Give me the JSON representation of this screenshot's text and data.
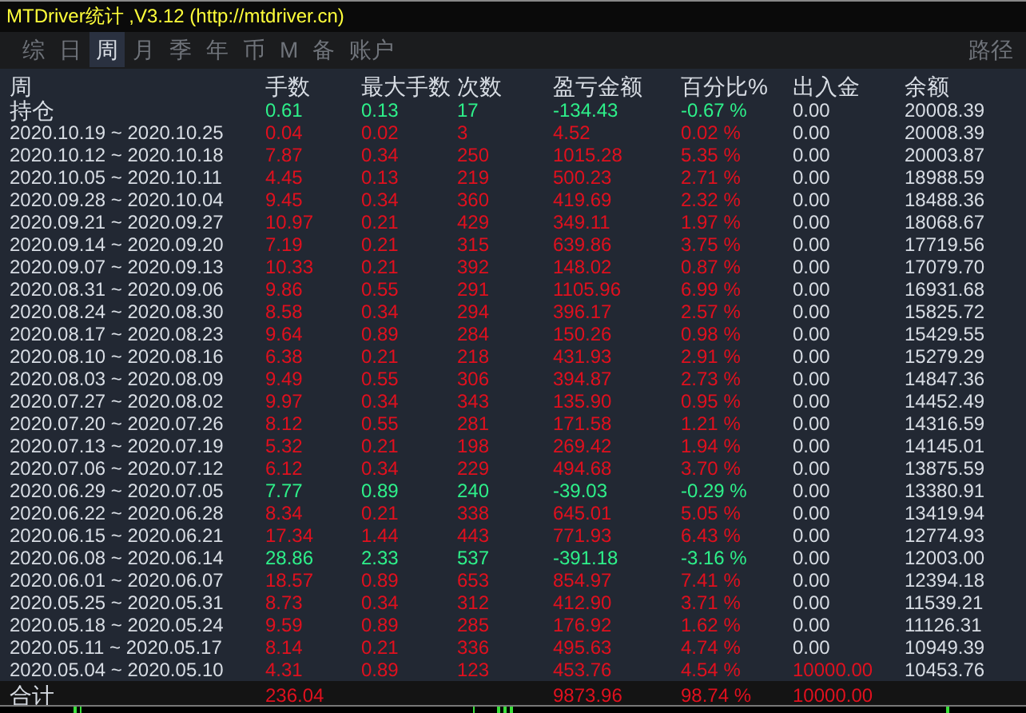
{
  "window": {
    "title": "MTDriver统计 ,V3.12 (http://mtdriver.cn)"
  },
  "tabs": [
    {
      "label": "综",
      "selected": false
    },
    {
      "label": "日",
      "selected": false
    },
    {
      "label": "周",
      "selected": true
    },
    {
      "label": "月",
      "selected": false
    },
    {
      "label": "季",
      "selected": false
    },
    {
      "label": "年",
      "selected": false
    },
    {
      "label": "币",
      "selected": false
    },
    {
      "label": "M",
      "selected": false
    },
    {
      "label": "备",
      "selected": false
    },
    {
      "label": "账户",
      "selected": false
    },
    {
      "label": "路径",
      "selected": false
    }
  ],
  "table": {
    "columns": [
      "周",
      "手数",
      "最大手数",
      "次数",
      "盈亏金额",
      "百分比%",
      "出入金",
      "余额"
    ],
    "rows": [
      {
        "period": "持仓",
        "lots": "0.61",
        "max_lots": "0.13",
        "count": "17",
        "pl": "-134.43",
        "pct": "-0.67 %",
        "deposit": "0.00",
        "balance": "20008.39",
        "loss": true,
        "deposit_nonzero": false
      },
      {
        "period": "2020.10.19 ~ 2020.10.25",
        "lots": "0.04",
        "max_lots": "0.02",
        "count": "3",
        "pl": "4.52",
        "pct": "0.02 %",
        "deposit": "0.00",
        "balance": "20008.39",
        "loss": false,
        "deposit_nonzero": false
      },
      {
        "period": "2020.10.12 ~ 2020.10.18",
        "lots": "7.87",
        "max_lots": "0.34",
        "count": "250",
        "pl": "1015.28",
        "pct": "5.35 %",
        "deposit": "0.00",
        "balance": "20003.87",
        "loss": false,
        "deposit_nonzero": false
      },
      {
        "period": "2020.10.05 ~ 2020.10.11",
        "lots": "4.45",
        "max_lots": "0.13",
        "count": "219",
        "pl": "500.23",
        "pct": "2.71 %",
        "deposit": "0.00",
        "balance": "18988.59",
        "loss": false,
        "deposit_nonzero": false
      },
      {
        "period": "2020.09.28 ~ 2020.10.04",
        "lots": "9.45",
        "max_lots": "0.34",
        "count": "360",
        "pl": "419.69",
        "pct": "2.32 %",
        "deposit": "0.00",
        "balance": "18488.36",
        "loss": false,
        "deposit_nonzero": false
      },
      {
        "period": "2020.09.21 ~ 2020.09.27",
        "lots": "10.97",
        "max_lots": "0.21",
        "count": "429",
        "pl": "349.11",
        "pct": "1.97 %",
        "deposit": "0.00",
        "balance": "18068.67",
        "loss": false,
        "deposit_nonzero": false
      },
      {
        "period": "2020.09.14 ~ 2020.09.20",
        "lots": "7.19",
        "max_lots": "0.21",
        "count": "315",
        "pl": "639.86",
        "pct": "3.75 %",
        "deposit": "0.00",
        "balance": "17719.56",
        "loss": false,
        "deposit_nonzero": false
      },
      {
        "period": "2020.09.07 ~ 2020.09.13",
        "lots": "10.33",
        "max_lots": "0.21",
        "count": "392",
        "pl": "148.02",
        "pct": "0.87 %",
        "deposit": "0.00",
        "balance": "17079.70",
        "loss": false,
        "deposit_nonzero": false
      },
      {
        "period": "2020.08.31 ~ 2020.09.06",
        "lots": "9.86",
        "max_lots": "0.55",
        "count": "291",
        "pl": "1105.96",
        "pct": "6.99 %",
        "deposit": "0.00",
        "balance": "16931.68",
        "loss": false,
        "deposit_nonzero": false
      },
      {
        "period": "2020.08.24 ~ 2020.08.30",
        "lots": "8.58",
        "max_lots": "0.34",
        "count": "294",
        "pl": "396.17",
        "pct": "2.57 %",
        "deposit": "0.00",
        "balance": "15825.72",
        "loss": false,
        "deposit_nonzero": false
      },
      {
        "period": "2020.08.17 ~ 2020.08.23",
        "lots": "9.64",
        "max_lots": "0.89",
        "count": "284",
        "pl": "150.26",
        "pct": "0.98 %",
        "deposit": "0.00",
        "balance": "15429.55",
        "loss": false,
        "deposit_nonzero": false
      },
      {
        "period": "2020.08.10 ~ 2020.08.16",
        "lots": "6.38",
        "max_lots": "0.21",
        "count": "218",
        "pl": "431.93",
        "pct": "2.91 %",
        "deposit": "0.00",
        "balance": "15279.29",
        "loss": false,
        "deposit_nonzero": false
      },
      {
        "period": "2020.08.03 ~ 2020.08.09",
        "lots": "9.49",
        "max_lots": "0.55",
        "count": "306",
        "pl": "394.87",
        "pct": "2.73 %",
        "deposit": "0.00",
        "balance": "14847.36",
        "loss": false,
        "deposit_nonzero": false
      },
      {
        "period": "2020.07.27 ~ 2020.08.02",
        "lots": "9.97",
        "max_lots": "0.34",
        "count": "343",
        "pl": "135.90",
        "pct": "0.95 %",
        "deposit": "0.00",
        "balance": "14452.49",
        "loss": false,
        "deposit_nonzero": false
      },
      {
        "period": "2020.07.20 ~ 2020.07.26",
        "lots": "8.12",
        "max_lots": "0.55",
        "count": "281",
        "pl": "171.58",
        "pct": "1.21 %",
        "deposit": "0.00",
        "balance": "14316.59",
        "loss": false,
        "deposit_nonzero": false
      },
      {
        "period": "2020.07.13 ~ 2020.07.19",
        "lots": "5.32",
        "max_lots": "0.21",
        "count": "198",
        "pl": "269.42",
        "pct": "1.94 %",
        "deposit": "0.00",
        "balance": "14145.01",
        "loss": false,
        "deposit_nonzero": false
      },
      {
        "period": "2020.07.06 ~ 2020.07.12",
        "lots": "6.12",
        "max_lots": "0.34",
        "count": "229",
        "pl": "494.68",
        "pct": "3.70 %",
        "deposit": "0.00",
        "balance": "13875.59",
        "loss": false,
        "deposit_nonzero": false
      },
      {
        "period": "2020.06.29 ~ 2020.07.05",
        "lots": "7.77",
        "max_lots": "0.89",
        "count": "240",
        "pl": "-39.03",
        "pct": "-0.29 %",
        "deposit": "0.00",
        "balance": "13380.91",
        "loss": true,
        "deposit_nonzero": false
      },
      {
        "period": "2020.06.22 ~ 2020.06.28",
        "lots": "8.34",
        "max_lots": "0.21",
        "count": "338",
        "pl": "645.01",
        "pct": "5.05 %",
        "deposit": "0.00",
        "balance": "13419.94",
        "loss": false,
        "deposit_nonzero": false
      },
      {
        "period": "2020.06.15 ~ 2020.06.21",
        "lots": "17.34",
        "max_lots": "1.44",
        "count": "443",
        "pl": "771.93",
        "pct": "6.43 %",
        "deposit": "0.00",
        "balance": "12774.93",
        "loss": false,
        "deposit_nonzero": false
      },
      {
        "period": "2020.06.08 ~ 2020.06.14",
        "lots": "28.86",
        "max_lots": "2.33",
        "count": "537",
        "pl": "-391.18",
        "pct": "-3.16 %",
        "deposit": "0.00",
        "balance": "12003.00",
        "loss": true,
        "deposit_nonzero": false
      },
      {
        "period": "2020.06.01 ~ 2020.06.07",
        "lots": "18.57",
        "max_lots": "0.89",
        "count": "653",
        "pl": "854.97",
        "pct": "7.41 %",
        "deposit": "0.00",
        "balance": "12394.18",
        "loss": false,
        "deposit_nonzero": false
      },
      {
        "period": "2020.05.25 ~ 2020.05.31",
        "lots": "8.73",
        "max_lots": "0.34",
        "count": "312",
        "pl": "412.90",
        "pct": "3.71 %",
        "deposit": "0.00",
        "balance": "11539.21",
        "loss": false,
        "deposit_nonzero": false
      },
      {
        "period": "2020.05.18 ~ 2020.05.24",
        "lots": "9.59",
        "max_lots": "0.89",
        "count": "285",
        "pl": "176.92",
        "pct": "1.62 %",
        "deposit": "0.00",
        "balance": "11126.31",
        "loss": false,
        "deposit_nonzero": false
      },
      {
        "period": "2020.05.11 ~ 2020.05.17",
        "lots": "8.14",
        "max_lots": "0.21",
        "count": "336",
        "pl": "495.63",
        "pct": "4.74 %",
        "deposit": "0.00",
        "balance": "10949.39",
        "loss": false,
        "deposit_nonzero": false
      },
      {
        "period": "2020.05.04 ~ 2020.05.10",
        "lots": "4.31",
        "max_lots": "0.89",
        "count": "123",
        "pl": "453.76",
        "pct": "4.54 %",
        "deposit": "10000.00",
        "balance": "10453.76",
        "loss": false,
        "deposit_nonzero": true
      }
    ],
    "total": {
      "label": "合计",
      "lots": "236.04",
      "pl": "9873.96",
      "pct": "98.74 %",
      "deposit": "10000.00"
    }
  }
}
